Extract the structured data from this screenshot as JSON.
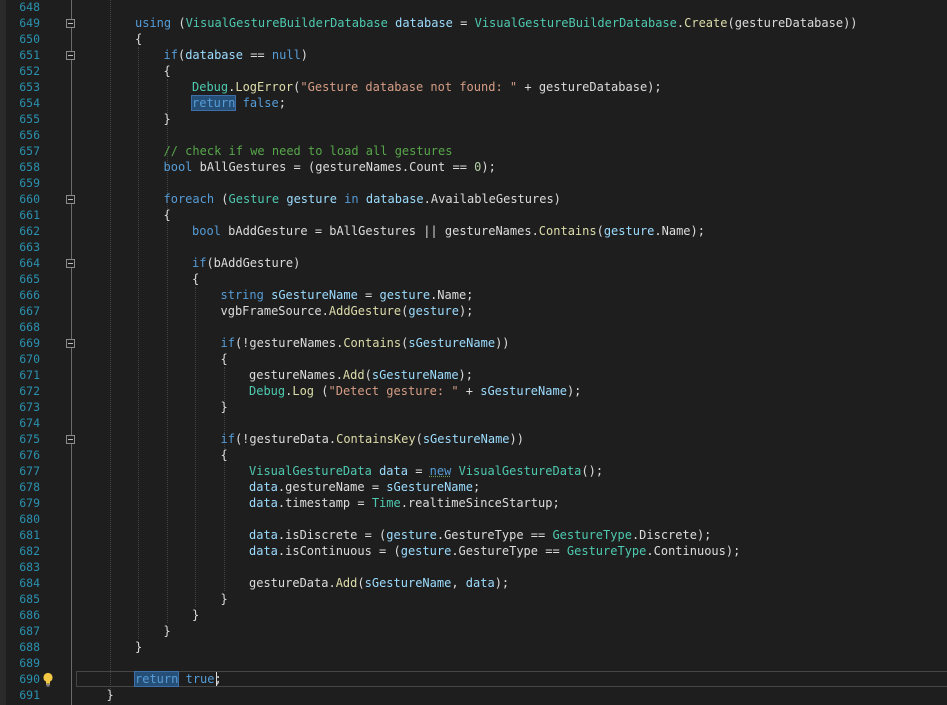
{
  "editor": {
    "lines": [
      {
        "num": "648",
        "tokens": []
      },
      {
        "num": "649",
        "fold": true,
        "indent": 2,
        "tokens": [
          {
            "t": "using",
            "c": "kw"
          },
          {
            "t": " (",
            "c": "pl"
          },
          {
            "t": "VisualGestureBuilderDatabase",
            "c": "ty"
          },
          {
            "t": " ",
            "c": "pl"
          },
          {
            "t": "database",
            "c": "var"
          },
          {
            "t": " = ",
            "c": "pl"
          },
          {
            "t": "VisualGestureBuilderDatabase",
            "c": "ty"
          },
          {
            "t": ".",
            "c": "pl"
          },
          {
            "t": "Create",
            "c": "fn"
          },
          {
            "t": "(gestureDatabase))",
            "c": "pl"
          }
        ]
      },
      {
        "num": "650",
        "indent": 2,
        "tokens": [
          {
            "t": "{",
            "c": "pl"
          }
        ]
      },
      {
        "num": "651",
        "fold": true,
        "indent": 3,
        "tokens": [
          {
            "t": "if",
            "c": "kw"
          },
          {
            "t": "(",
            "c": "pl"
          },
          {
            "t": "database",
            "c": "var"
          },
          {
            "t": " == ",
            "c": "pl"
          },
          {
            "t": "null",
            "c": "kw"
          },
          {
            "t": ")",
            "c": "pl"
          }
        ]
      },
      {
        "num": "652",
        "indent": 3,
        "tokens": [
          {
            "t": "{",
            "c": "pl"
          }
        ]
      },
      {
        "num": "653",
        "indent": 4,
        "tokens": [
          {
            "t": "Debug",
            "c": "ty"
          },
          {
            "t": ".",
            "c": "pl"
          },
          {
            "t": "LogError",
            "c": "fn"
          },
          {
            "t": "(",
            "c": "pl"
          },
          {
            "t": "\"Gesture database not found: \"",
            "c": "str"
          },
          {
            "t": " + gestureDatabase);",
            "c": "pl"
          }
        ]
      },
      {
        "num": "654",
        "indent": 4,
        "tokens": [
          {
            "t": "return",
            "c": "hl-kw"
          },
          {
            "t": " ",
            "c": "pl"
          },
          {
            "t": "false",
            "c": "kw"
          },
          {
            "t": ";",
            "c": "pl"
          }
        ]
      },
      {
        "num": "655",
        "indent": 3,
        "tokens": [
          {
            "t": "}",
            "c": "pl"
          }
        ]
      },
      {
        "num": "656",
        "tokens": []
      },
      {
        "num": "657",
        "indent": 3,
        "tokens": [
          {
            "t": "// check if we need to load all gestures",
            "c": "cm"
          }
        ]
      },
      {
        "num": "658",
        "indent": 3,
        "tokens": [
          {
            "t": "bool",
            "c": "kw"
          },
          {
            "t": " bAllGestures = (gestureNames.Count == ",
            "c": "pl"
          },
          {
            "t": "0",
            "c": "num"
          },
          {
            "t": ");",
            "c": "pl"
          }
        ]
      },
      {
        "num": "659",
        "tokens": []
      },
      {
        "num": "660",
        "fold": true,
        "indent": 3,
        "tokens": [
          {
            "t": "foreach",
            "c": "kw"
          },
          {
            "t": " (",
            "c": "pl"
          },
          {
            "t": "Gesture",
            "c": "ty"
          },
          {
            "t": " ",
            "c": "pl"
          },
          {
            "t": "gesture",
            "c": "var"
          },
          {
            "t": " ",
            "c": "pl"
          },
          {
            "t": "in",
            "c": "kw"
          },
          {
            "t": " ",
            "c": "pl"
          },
          {
            "t": "database",
            "c": "var"
          },
          {
            "t": ".AvailableGestures)",
            "c": "pl"
          }
        ]
      },
      {
        "num": "661",
        "indent": 3,
        "tokens": [
          {
            "t": "{",
            "c": "pl"
          }
        ]
      },
      {
        "num": "662",
        "indent": 4,
        "tokens": [
          {
            "t": "bool",
            "c": "kw"
          },
          {
            "t": " bAddGesture = bAllGestures || gestureNames.",
            "c": "pl"
          },
          {
            "t": "Contains",
            "c": "fn"
          },
          {
            "t": "(",
            "c": "pl"
          },
          {
            "t": "gesture",
            "c": "var"
          },
          {
            "t": ".Name);",
            "c": "pl"
          }
        ]
      },
      {
        "num": "663",
        "tokens": []
      },
      {
        "num": "664",
        "fold": true,
        "indent": 4,
        "tokens": [
          {
            "t": "if",
            "c": "kw"
          },
          {
            "t": "(bAddGesture)",
            "c": "pl"
          }
        ]
      },
      {
        "num": "665",
        "indent": 4,
        "tokens": [
          {
            "t": "{",
            "c": "pl"
          }
        ]
      },
      {
        "num": "666",
        "indent": 5,
        "tokens": [
          {
            "t": "string",
            "c": "kw"
          },
          {
            "t": " ",
            "c": "pl"
          },
          {
            "t": "sGestureName",
            "c": "var"
          },
          {
            "t": " = ",
            "c": "pl"
          },
          {
            "t": "gesture",
            "c": "var"
          },
          {
            "t": ".Name;",
            "c": "pl"
          }
        ]
      },
      {
        "num": "667",
        "indent": 5,
        "tokens": [
          {
            "t": "vgbFrameSource.",
            "c": "pl"
          },
          {
            "t": "AddGesture",
            "c": "fn"
          },
          {
            "t": "(",
            "c": "pl"
          },
          {
            "t": "gesture",
            "c": "var"
          },
          {
            "t": ");",
            "c": "pl"
          }
        ]
      },
      {
        "num": "668",
        "tokens": []
      },
      {
        "num": "669",
        "fold": true,
        "indent": 5,
        "tokens": [
          {
            "t": "if",
            "c": "kw"
          },
          {
            "t": "(!gestureNames.",
            "c": "pl"
          },
          {
            "t": "Contains",
            "c": "fn"
          },
          {
            "t": "(",
            "c": "pl"
          },
          {
            "t": "sGestureName",
            "c": "var"
          },
          {
            "t": "))",
            "c": "pl"
          }
        ]
      },
      {
        "num": "670",
        "indent": 5,
        "tokens": [
          {
            "t": "{",
            "c": "pl"
          }
        ]
      },
      {
        "num": "671",
        "indent": 6,
        "tokens": [
          {
            "t": "gestureNames.",
            "c": "pl"
          },
          {
            "t": "Add",
            "c": "fn"
          },
          {
            "t": "(",
            "c": "pl"
          },
          {
            "t": "sGestureName",
            "c": "var"
          },
          {
            "t": ");",
            "c": "pl"
          }
        ]
      },
      {
        "num": "672",
        "indent": 6,
        "tokens": [
          {
            "t": "Debug",
            "c": "ty"
          },
          {
            "t": ".",
            "c": "pl"
          },
          {
            "t": "Log",
            "c": "fn"
          },
          {
            "t": " (",
            "c": "pl"
          },
          {
            "t": "\"Detect gesture: \"",
            "c": "str"
          },
          {
            "t": " + ",
            "c": "pl"
          },
          {
            "t": "sGestureName",
            "c": "var"
          },
          {
            "t": ");",
            "c": "pl"
          }
        ]
      },
      {
        "num": "673",
        "indent": 5,
        "tokens": [
          {
            "t": "}",
            "c": "pl"
          }
        ]
      },
      {
        "num": "674",
        "tokens": []
      },
      {
        "num": "675",
        "fold": true,
        "indent": 5,
        "tokens": [
          {
            "t": "if",
            "c": "kw"
          },
          {
            "t": "(!gestureData.",
            "c": "pl"
          },
          {
            "t": "ContainsKey",
            "c": "fn"
          },
          {
            "t": "(",
            "c": "pl"
          },
          {
            "t": "sGestureName",
            "c": "var"
          },
          {
            "t": "))",
            "c": "pl"
          }
        ]
      },
      {
        "num": "676",
        "indent": 5,
        "tokens": [
          {
            "t": "{",
            "c": "pl"
          }
        ]
      },
      {
        "num": "677",
        "indent": 6,
        "tokens": [
          {
            "t": "VisualGestureData",
            "c": "ty"
          },
          {
            "t": " ",
            "c": "pl"
          },
          {
            "t": "data",
            "c": "var"
          },
          {
            "t": " = ",
            "c": "pl"
          },
          {
            "t": "new",
            "c": "kw sq"
          },
          {
            "t": " ",
            "c": "pl"
          },
          {
            "t": "VisualGestureData",
            "c": "ty"
          },
          {
            "t": "();",
            "c": "pl"
          }
        ]
      },
      {
        "num": "678",
        "indent": 6,
        "tokens": [
          {
            "t": "data",
            "c": "var"
          },
          {
            "t": ".gestureName = ",
            "c": "pl"
          },
          {
            "t": "sGestureName",
            "c": "var"
          },
          {
            "t": ";",
            "c": "pl"
          }
        ]
      },
      {
        "num": "679",
        "indent": 6,
        "tokens": [
          {
            "t": "data",
            "c": "var"
          },
          {
            "t": ".timestamp = ",
            "c": "pl"
          },
          {
            "t": "Time",
            "c": "ty"
          },
          {
            "t": ".realtimeSinceStartup;",
            "c": "pl"
          }
        ]
      },
      {
        "num": "680",
        "tokens": []
      },
      {
        "num": "681",
        "indent": 6,
        "tokens": [
          {
            "t": "data",
            "c": "var"
          },
          {
            "t": ".isDiscrete = (",
            "c": "pl"
          },
          {
            "t": "gesture",
            "c": "var"
          },
          {
            "t": ".GestureType == ",
            "c": "pl"
          },
          {
            "t": "GestureType",
            "c": "ty"
          },
          {
            "t": ".Discrete);",
            "c": "pl"
          }
        ]
      },
      {
        "num": "682",
        "indent": 6,
        "tokens": [
          {
            "t": "data",
            "c": "var"
          },
          {
            "t": ".isContinuous = (",
            "c": "pl"
          },
          {
            "t": "gesture",
            "c": "var"
          },
          {
            "t": ".GestureType == ",
            "c": "pl"
          },
          {
            "t": "GestureType",
            "c": "ty"
          },
          {
            "t": ".Continuous);",
            "c": "pl"
          }
        ]
      },
      {
        "num": "683",
        "tokens": []
      },
      {
        "num": "684",
        "indent": 6,
        "tokens": [
          {
            "t": "gestureData.",
            "c": "pl"
          },
          {
            "t": "Add",
            "c": "fn"
          },
          {
            "t": "(",
            "c": "pl"
          },
          {
            "t": "sGestureName",
            "c": "var"
          },
          {
            "t": ", ",
            "c": "pl"
          },
          {
            "t": "data",
            "c": "var"
          },
          {
            "t": ");",
            "c": "pl"
          }
        ]
      },
      {
        "num": "685",
        "indent": 5,
        "tokens": [
          {
            "t": "}",
            "c": "pl"
          }
        ]
      },
      {
        "num": "686",
        "indent": 4,
        "tokens": [
          {
            "t": "}",
            "c": "pl"
          }
        ]
      },
      {
        "num": "687",
        "indent": 3,
        "tokens": [
          {
            "t": "}",
            "c": "pl"
          }
        ]
      },
      {
        "num": "688",
        "indent": 2,
        "tokens": [
          {
            "t": "}",
            "c": "pl"
          }
        ]
      },
      {
        "num": "689",
        "tokens": []
      },
      {
        "num": "690",
        "indent": 2,
        "current": true,
        "tokens": [
          {
            "t": "return",
            "c": "hl-kw"
          },
          {
            "t": " ",
            "c": "pl"
          },
          {
            "t": "true",
            "c": "kw"
          },
          {
            "t": ";",
            "c": "pl"
          }
        ]
      },
      {
        "num": "691",
        "indent": 1,
        "tokens": [
          {
            "t": "}",
            "c": "pl"
          }
        ]
      }
    ],
    "lightbulb_icon": "lightbulb-icon",
    "colors": {
      "background": "#1e1e1e",
      "line_number": "#2b91af",
      "keyword": "#569cd6",
      "type": "#4ec9b0",
      "method": "#dcdcaa",
      "string": "#d69d85",
      "comment": "#57a64a",
      "variable": "#9cdcfe",
      "number": "#b5cea8"
    }
  }
}
